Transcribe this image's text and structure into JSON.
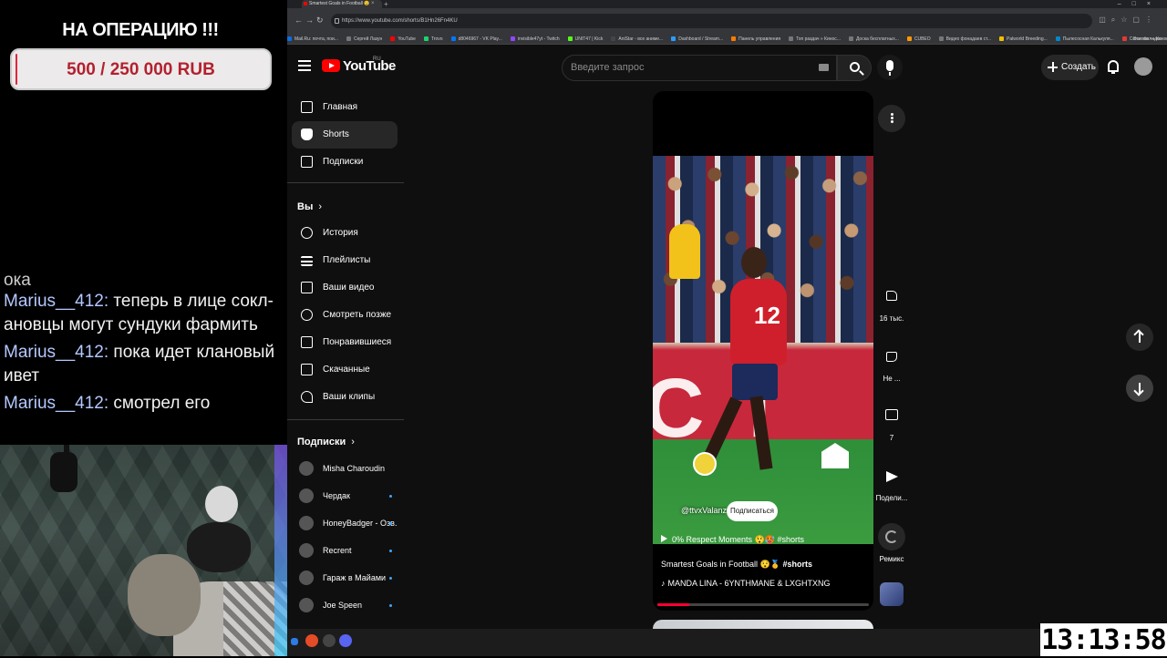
{
  "overlay": {
    "donation": {
      "title": "НА ОПЕРАЦИЮ !!!",
      "amount": "500 / 250 000 RUB",
      "progress_percent": 0.2,
      "colors": {
        "bar_bg": "#eceaea",
        "text": "#b3202e",
        "fill": "#e2263b"
      }
    },
    "chat": {
      "partial_text": "ока",
      "messages": [
        {
          "user": "Marius__412:",
          "text": "теперь в лице сокл-",
          "continuation": "ановцы могут сундуки фармить"
        },
        {
          "user": "Marius__412:",
          "text": "пока идет клановый",
          "continuation": "ивет"
        },
        {
          "user": "Marius__412:",
          "text": "смотрел его",
          "continuation": ""
        }
      ]
    }
  },
  "browser": {
    "tab_title": "Smartest Goals in Football 😯",
    "tab_close": "×",
    "new_tab": "+",
    "window_controls": "–□×",
    "url": "https://www.youtube.com/shorts/B1Hn26Fn4KU",
    "bookmarks": [
      {
        "label": "Mail.Ru: почта, пои...",
        "color": "#0a6ee5"
      },
      {
        "label": "Сергей Лазун",
        "color": "#777"
      },
      {
        "label": "YouTube",
        "color": "#ff0000"
      },
      {
        "label": "Trovo",
        "color": "#19d66b"
      },
      {
        "label": "d8046967 - VK Play...",
        "color": "#0077ff"
      },
      {
        "label": "invisible47yt - Twitch",
        "color": "#9146ff"
      },
      {
        "label": "UNIT47 | Kick",
        "color": "#53fc18"
      },
      {
        "label": "AniStar - все аниме...",
        "color": "#444"
      },
      {
        "label": "Dashboard / Stream...",
        "color": "#2b9cff"
      },
      {
        "label": "Панель управления",
        "color": "#ff7a00"
      },
      {
        "label": "Топ раздач » Кинос...",
        "color": "#777"
      },
      {
        "label": "Доска бесплатных...",
        "color": "#777"
      },
      {
        "label": "CUBEO",
        "color": "#ff9900"
      },
      {
        "label": "Видео фонадаев ст...",
        "color": "#777"
      },
      {
        "label": "Palworld Breeding...",
        "color": "#f0c000"
      },
      {
        "label": "Пылесосная Калькуля...",
        "color": "#0088cc"
      },
      {
        "label": "Convertio — Конве...",
        "color": "#e53935"
      }
    ],
    "bookmarks_more": "»",
    "bookmarks_all": "Все закладки"
  },
  "youtube": {
    "wordmark": "YouTube",
    "region": "RU",
    "search_placeholder": "Введите запрос",
    "create_label": "Создать",
    "sidebar": {
      "main": [
        {
          "label": "Главная",
          "icon": "home-icon"
        },
        {
          "label": "Shorts",
          "icon": "shorts-icon",
          "active": true
        },
        {
          "label": "Подписки",
          "icon": "subscriptions-icon"
        }
      ],
      "you_heading": "Вы",
      "you": [
        {
          "label": "История",
          "icon": "history-icon"
        },
        {
          "label": "Плейлисты",
          "icon": "playlists-icon"
        },
        {
          "label": "Ваши видео",
          "icon": "your-videos-icon"
        },
        {
          "label": "Смотреть позже",
          "icon": "watch-later-icon"
        },
        {
          "label": "Понравившиеся",
          "icon": "liked-icon"
        },
        {
          "label": "Скачанные",
          "icon": "downloads-icon"
        },
        {
          "label": "Ваши клипы",
          "icon": "clips-icon"
        }
      ],
      "subs_heading": "Подписки",
      "subscriptions": [
        {
          "label": "Misha Charoudin",
          "new": false
        },
        {
          "label": "Чердак",
          "new": true
        },
        {
          "label": "HoneyBadger - Озв...",
          "new": true
        },
        {
          "label": "Recrent",
          "new": true
        },
        {
          "label": "Гараж в Майами",
          "new": true
        },
        {
          "label": "Joe Speen",
          "new": true
        }
      ]
    },
    "short": {
      "handle": "@ttvxValanz",
      "subscribe": "Подписаться",
      "tag_line": "0% Respect Moments 😲🥵 #shorts",
      "title": "Smartest Goals in Football 😯🥇",
      "title_hashtag": "#shorts",
      "music": "MANDA LINA - 6YNTHMANE & LXGHTXNG",
      "progress_fraction": 0.15,
      "jersey_number": "12",
      "board_text": "C f"
    },
    "actions": {
      "likes": "16 тыс.",
      "dislike": "Не ...",
      "comments": "7",
      "share": "Подели...",
      "remix": "Ремикс"
    }
  },
  "clock": "13:13:58"
}
